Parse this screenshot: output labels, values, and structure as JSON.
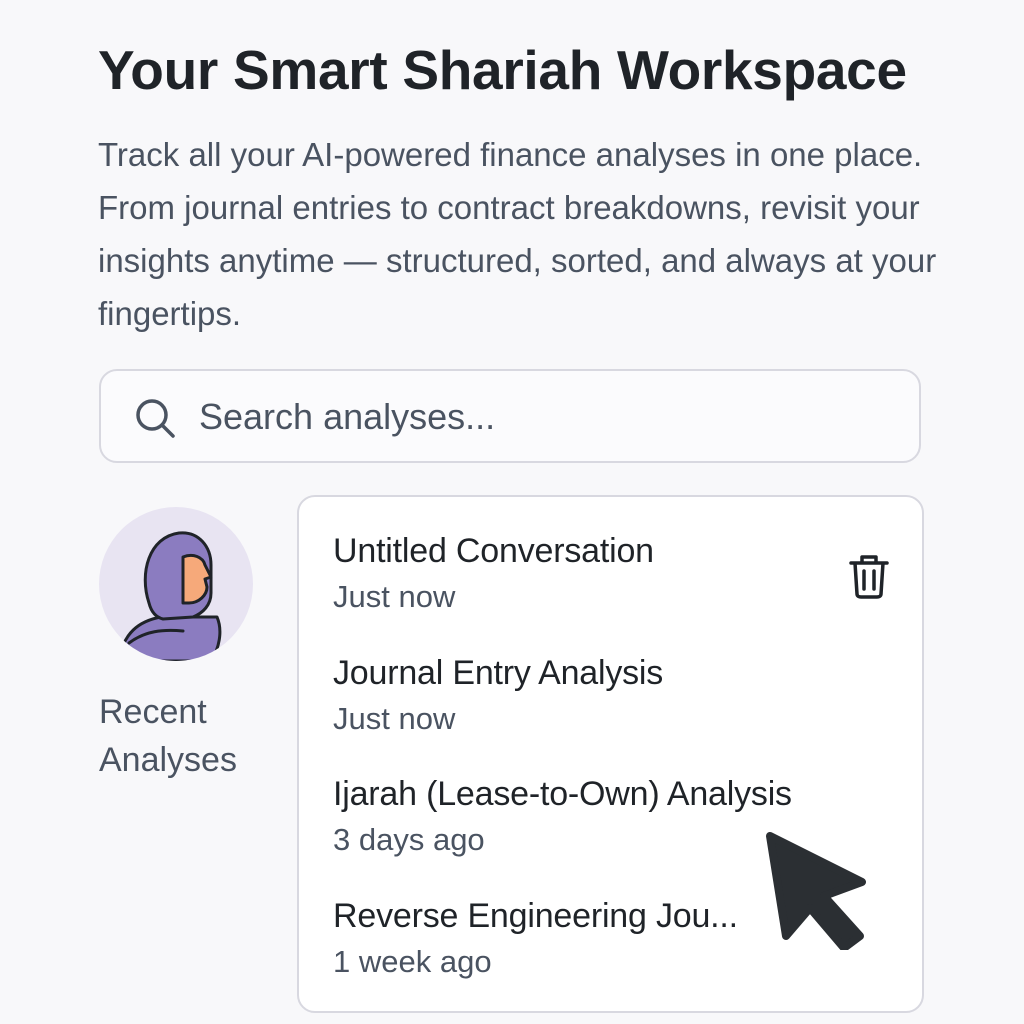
{
  "header": {
    "title": "Your Smart Shariah Workspace",
    "subtitle": "Track all your AI-powered finance analyses in one place. From journal entries to contract breakdowns, revisit your insights anytime — structured, sorted, and always at your fingertips."
  },
  "search": {
    "placeholder": "Search analyses...",
    "value": "",
    "icon": "search-icon"
  },
  "sidebar": {
    "label": "Recent Analyses",
    "avatar_icon": "hijab-woman-avatar"
  },
  "analyses": [
    {
      "title": "Untitled Conversation",
      "time": "Just now"
    },
    {
      "title": "Journal Entry Analysis",
      "time": "Just now"
    },
    {
      "title": "Ijarah (Lease-to-Own) Analysis",
      "time": "3 days ago"
    },
    {
      "title": "Reverse Engineering Jou...",
      "time": "1 week ago"
    }
  ],
  "actions": {
    "delete_icon": "trash-icon"
  },
  "colors": {
    "background": "#f8f8fa",
    "text_primary": "#1f2328",
    "text_secondary": "#4a5361",
    "border": "#d8d8e0",
    "avatar_bg": "#e8e4f2",
    "hijab": "#8b7cc0",
    "skin": "#f6a97a"
  }
}
